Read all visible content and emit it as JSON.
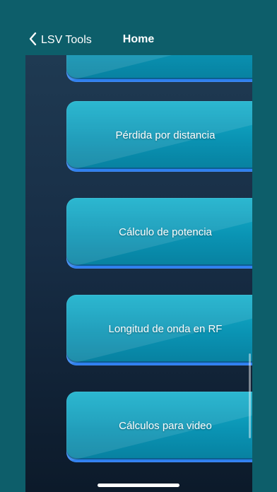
{
  "nav": {
    "back_label": "LSV Tools",
    "title": "Home"
  },
  "menu": {
    "items": [
      {
        "label": ""
      },
      {
        "label": "Pérdida por distancia"
      },
      {
        "label": "Cálculo de potencia"
      },
      {
        "label": "Longitud de onda en RF"
      },
      {
        "label": "Cálculos para video"
      }
    ]
  },
  "colors": {
    "background_teal": "#0d5e6a",
    "card_primary": "#0a93b3",
    "card_border_accent": "#2f7ff0",
    "content_background": "#172d45"
  },
  "icons": {
    "back": "chevron-left-icon"
  }
}
